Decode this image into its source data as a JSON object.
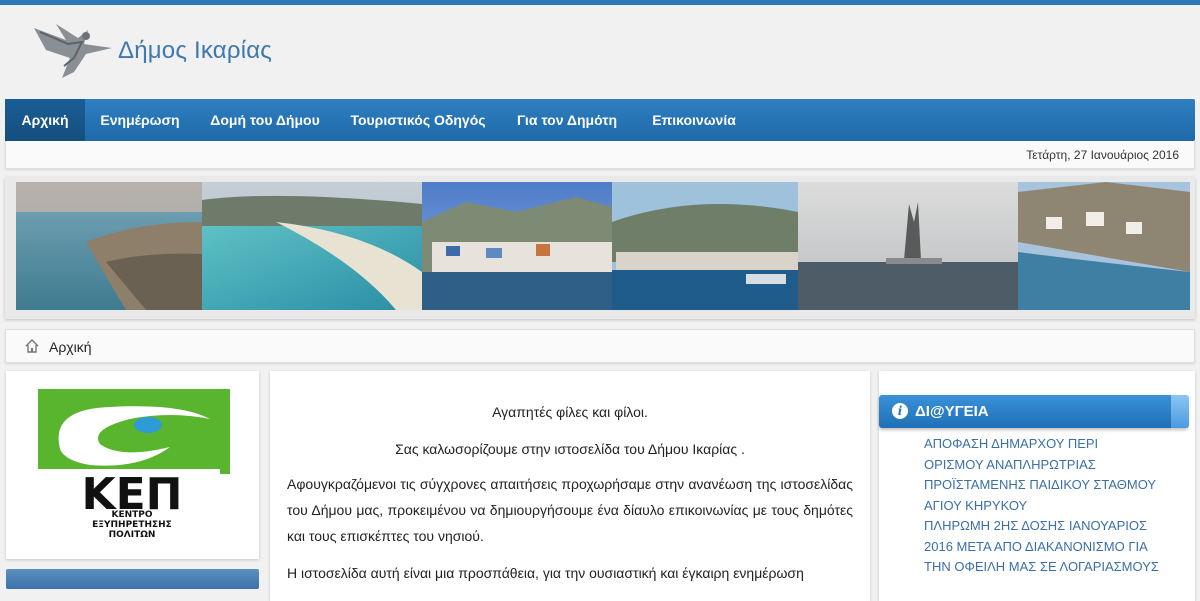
{
  "site": {
    "title": "Δήμος Ικαρίας"
  },
  "nav": {
    "items": [
      {
        "label": "Αρχική"
      },
      {
        "label": "Ενημέρωση"
      },
      {
        "label": "Δομή του Δήμου"
      },
      {
        "label": "Τουριστικός Οδηγός"
      },
      {
        "label": "Για τον Δημότη"
      },
      {
        "label": "Επικοινωνία"
      }
    ]
  },
  "date": "Τετάρτη, 27 Ιανουάριος 2016",
  "breadcrumb": {
    "label": "Αρχική"
  },
  "kep": {
    "title": "ΚΕΠ",
    "subtitle_line1": "ΚΕΝΤΡΟ",
    "subtitle_line2": "ΕΞΥΠΗΡΕΤΗΣΗΣ",
    "subtitle_line3": "ΠΟΛΙΤΩΝ"
  },
  "welcome": {
    "greeting": "Αγαπητές φίλες και φίλοι.",
    "intro": "Σας καλωσορίζουμε στην ιστοσελίδα του Δήμου Ικαρίας .",
    "paragraph1": "Αφουγκραζόμενοι τις σύγχρονες απαιτήσεις προχωρήσαμε στην ανανέωση της ιστοσελίδας του Δήμου μας, προκειμένου να δημιουργήσουμε ένα δίαυλο επικοινωνίας με τους δημότες και τους επισκέπτες του νησιού.",
    "paragraph2": "Η ιστοσελίδα αυτή είναι μια προσπάθεια, για την ουσιαστική και έγκαιρη ενημέρωση"
  },
  "diavgeia": {
    "title": "ΔΙ@ΥΓΕΙΑ",
    "lines": [
      "ΑΠΟΦΑΣΗ ΔΗΜΑΡΧΟΥ ΠΕΡΙ",
      "ΟΡΙΣΜΟΥ ΑΝΑΠΛΗΡΩΤΡΙΑΣ",
      "ΠΡΟΪΣΤΑΜΕΝΗΣ ΠΑΙΔΙΚΟΥ ΣΤΑΘΜΟΥ",
      "ΑΓΙΟΥ ΚΗΡΥΚΟΥ",
      "ΠΛΗΡΩΜΗ 2ΗΣ ΔΟΣΗΣ ΙΑΝΟΥΑΡΙΟΣ",
      "2016 ΜΕΤΑ ΑΠΟ ΔΙΑΚΑΝΟΝΙΣΜΟ ΓΙΑ",
      "ΤΗΝ ΟΦΕΙΛΗ ΜΑΣ ΣΕ ΛΟΓΑΡΙΑΣΜΟΥΣ"
    ]
  },
  "colors": {
    "accent": "#2c78b8",
    "link": "#3a6fa8",
    "kep_green": "#5ab52e"
  },
  "icons": {
    "home": "home-icon",
    "info": "info-icon",
    "logo": "winged-figure-logo"
  }
}
